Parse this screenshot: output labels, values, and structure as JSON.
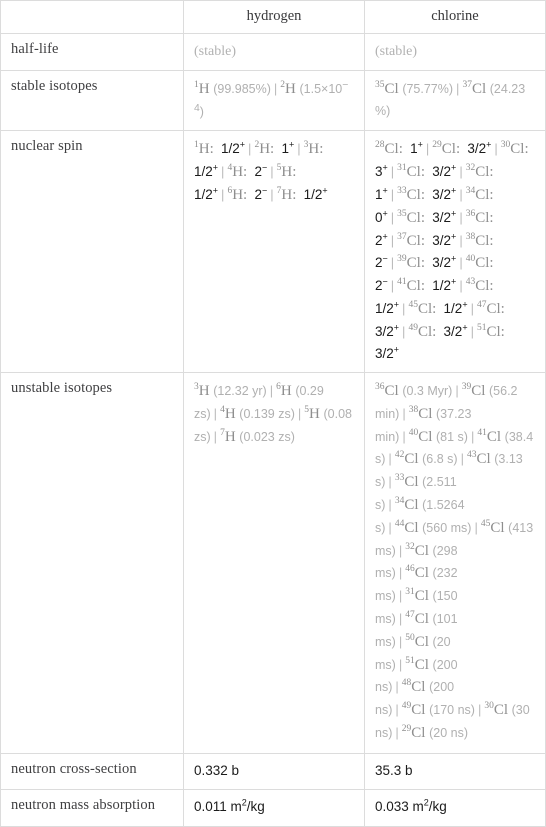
{
  "table": {
    "columns": [
      {
        "key": "label",
        "header": ""
      },
      {
        "key": "hydrogen",
        "header": "hydrogen"
      },
      {
        "key": "chlorine",
        "header": "chlorine"
      }
    ],
    "rows": [
      {
        "label": "half-life",
        "hydrogen": {
          "text": "(stable)"
        },
        "chlorine": {
          "text": "(stable)"
        }
      },
      {
        "label": "stable isotopes",
        "hydrogen": {
          "text": "1H (99.985%)  |  2H (1.5×10^-4)",
          "items": [
            {
              "mass": "1",
              "symbol": "H",
              "note": "(99.985%)"
            },
            {
              "mass": "2",
              "symbol": "H",
              "note": "(1.5×10",
              "note_sup": "−4",
              "note_tail": ")"
            }
          ]
        },
        "chlorine": {
          "text": "35Cl (75.77%)  |  37Cl (24.23%)",
          "items": [
            {
              "mass": "35",
              "symbol": "Cl",
              "note": "(75.77%)"
            },
            {
              "mass": "37",
              "symbol": "Cl",
              "note": "(24.23%)"
            }
          ]
        }
      },
      {
        "label": "nuclear spin",
        "hydrogen": {
          "text": "1H: 1/2+ | 2H: 1+ | 3H: 1/2+ | 4H: 2- | 5H: 1/2+ | 6H: 2- | 7H: 1/2+",
          "items": [
            {
              "mass": "1",
              "symbol": "H",
              "spin": "1/2",
              "sign": "+"
            },
            {
              "mass": "2",
              "symbol": "H",
              "spin": "1",
              "sign": "+"
            },
            {
              "mass": "3",
              "symbol": "H",
              "spin": "1/2",
              "sign": "+"
            },
            {
              "mass": "4",
              "symbol": "H",
              "spin": "2",
              "sign": "−"
            },
            {
              "mass": "5",
              "symbol": "H",
              "spin": "1/2",
              "sign": "+"
            },
            {
              "mass": "6",
              "symbol": "H",
              "spin": "2",
              "sign": "−"
            },
            {
              "mass": "7",
              "symbol": "H",
              "spin": "1/2",
              "sign": "+"
            }
          ]
        },
        "chlorine": {
          "text": "28Cl: 1+ | 29Cl: 3/2+ | 30Cl: 3+ | 31Cl: 3/2+ | 32Cl: 1+ | 33Cl: 3/2+ | 34Cl: 0+ | 35Cl: 3/2+ | 36Cl: 2+ | 37Cl: 3/2+ | 38Cl: 2- | 39Cl: 3/2+ | 40Cl: 2- | 41Cl: 1/2+ | 43Cl: 1/2+ | 45Cl: 1/2+ | 47Cl: 3/2+ | 49Cl: 3/2+ | 51Cl: 3/2+",
          "items": [
            {
              "mass": "28",
              "symbol": "Cl",
              "spin": "1",
              "sign": "+"
            },
            {
              "mass": "29",
              "symbol": "Cl",
              "spin": "3/2",
              "sign": "+"
            },
            {
              "mass": "30",
              "symbol": "Cl",
              "spin": "3",
              "sign": "+"
            },
            {
              "mass": "31",
              "symbol": "Cl",
              "spin": "3/2",
              "sign": "+"
            },
            {
              "mass": "32",
              "symbol": "Cl",
              "spin": "1",
              "sign": "+"
            },
            {
              "mass": "33",
              "symbol": "Cl",
              "spin": "3/2",
              "sign": "+"
            },
            {
              "mass": "34",
              "symbol": "Cl",
              "spin": "0",
              "sign": "+"
            },
            {
              "mass": "35",
              "symbol": "Cl",
              "spin": "3/2",
              "sign": "+"
            },
            {
              "mass": "36",
              "symbol": "Cl",
              "spin": "2",
              "sign": "+"
            },
            {
              "mass": "37",
              "symbol": "Cl",
              "spin": "3/2",
              "sign": "+"
            },
            {
              "mass": "38",
              "symbol": "Cl",
              "spin": "2",
              "sign": "−"
            },
            {
              "mass": "39",
              "symbol": "Cl",
              "spin": "3/2",
              "sign": "+"
            },
            {
              "mass": "40",
              "symbol": "Cl",
              "spin": "2",
              "sign": "−"
            },
            {
              "mass": "41",
              "symbol": "Cl",
              "spin": "1/2",
              "sign": "+"
            },
            {
              "mass": "43",
              "symbol": "Cl",
              "spin": "1/2",
              "sign": "+"
            },
            {
              "mass": "45",
              "symbol": "Cl",
              "spin": "1/2",
              "sign": "+"
            },
            {
              "mass": "47",
              "symbol": "Cl",
              "spin": "3/2",
              "sign": "+"
            },
            {
              "mass": "49",
              "symbol": "Cl",
              "spin": "3/2",
              "sign": "+"
            },
            {
              "mass": "51",
              "symbol": "Cl",
              "spin": "3/2",
              "sign": "+"
            }
          ]
        }
      },
      {
        "label": "unstable isotopes",
        "hydrogen": {
          "text": "3H (12.32 yr) | 6H (0.29 zs) | 4H (0.139 zs) | 5H (0.08 zs) | 7H (0.023 zs)",
          "items": [
            {
              "mass": "3",
              "symbol": "H",
              "note": "(12.32 yr)"
            },
            {
              "mass": "6",
              "symbol": "H",
              "note": "(0.29 zs)"
            },
            {
              "mass": "4",
              "symbol": "H",
              "note": "(0.139 zs)"
            },
            {
              "mass": "5",
              "symbol": "H",
              "note": "(0.08 zs)"
            },
            {
              "mass": "7",
              "symbol": "H",
              "note": "(0.023 zs)"
            }
          ]
        },
        "chlorine": {
          "text": "36Cl (0.3 Myr) | 39Cl (56.2 min) | 38Cl (37.23 min) | 40Cl (81 s) | 41Cl (38.4 s) | 42Cl (6.8 s) | 43Cl (3.13 s) | 33Cl (2.511 s) | 34Cl (1.5264 s) | 44Cl (560 ms) | 45Cl (413 ms) | 32Cl (298 ms) | 46Cl (232 ms) | 31Cl (150 ms) | 47Cl (101 ms) | 50Cl (20 ms) | 51Cl (200 ns) | 48Cl (200 ns) | 49Cl (170 ns) | 30Cl (30 ns) | 29Cl (20 ns)",
          "items": [
            {
              "mass": "36",
              "symbol": "Cl",
              "note": "(0.3 Myr)"
            },
            {
              "mass": "39",
              "symbol": "Cl",
              "note": "(56.2 min)"
            },
            {
              "mass": "38",
              "symbol": "Cl",
              "note": "(37.23 min)"
            },
            {
              "mass": "40",
              "symbol": "Cl",
              "note": "(81 s)"
            },
            {
              "mass": "41",
              "symbol": "Cl",
              "note": "(38.4 s)"
            },
            {
              "mass": "42",
              "symbol": "Cl",
              "note": "(6.8 s)"
            },
            {
              "mass": "43",
              "symbol": "Cl",
              "note": "(3.13 s)"
            },
            {
              "mass": "33",
              "symbol": "Cl",
              "note": "(2.511 s)"
            },
            {
              "mass": "34",
              "symbol": "Cl",
              "note": "(1.5264 s)"
            },
            {
              "mass": "44",
              "symbol": "Cl",
              "note": "(560 ms)"
            },
            {
              "mass": "45",
              "symbol": "Cl",
              "note": "(413 ms)"
            },
            {
              "mass": "32",
              "symbol": "Cl",
              "note": "(298 ms)"
            },
            {
              "mass": "46",
              "symbol": "Cl",
              "note": "(232 ms)"
            },
            {
              "mass": "31",
              "symbol": "Cl",
              "note": "(150 ms)"
            },
            {
              "mass": "47",
              "symbol": "Cl",
              "note": "(101 ms)"
            },
            {
              "mass": "50",
              "symbol": "Cl",
              "note": "(20 ms)"
            },
            {
              "mass": "51",
              "symbol": "Cl",
              "note": "(200 ns)"
            },
            {
              "mass": "48",
              "symbol": "Cl",
              "note": "(200 ns)"
            },
            {
              "mass": "49",
              "symbol": "Cl",
              "note": "(170 ns)"
            },
            {
              "mass": "30",
              "symbol": "Cl",
              "note": "(30 ns)"
            },
            {
              "mass": "29",
              "symbol": "Cl",
              "note": "(20 ns)"
            }
          ]
        }
      },
      {
        "label": "neutron cross-section",
        "hydrogen": {
          "text": "0.332 b"
        },
        "chlorine": {
          "text": "35.3 b"
        }
      },
      {
        "label": "neutron mass absorption",
        "hydrogen": {
          "text": "0.011 m2/kg",
          "value": "0.011 m",
          "sup": "2",
          "unit": "/kg"
        },
        "chlorine": {
          "text": "0.033 m2/kg",
          "value": "0.033 m",
          "sup": "2",
          "unit": "/kg"
        }
      }
    ]
  },
  "separator": "|",
  "colors": {
    "border": "#dcdcdc",
    "label_text": "#3f3f41",
    "value_text": "#1b1b1b",
    "dim_text": "#aaaaaa",
    "element_text": "#8e8e8e"
  }
}
